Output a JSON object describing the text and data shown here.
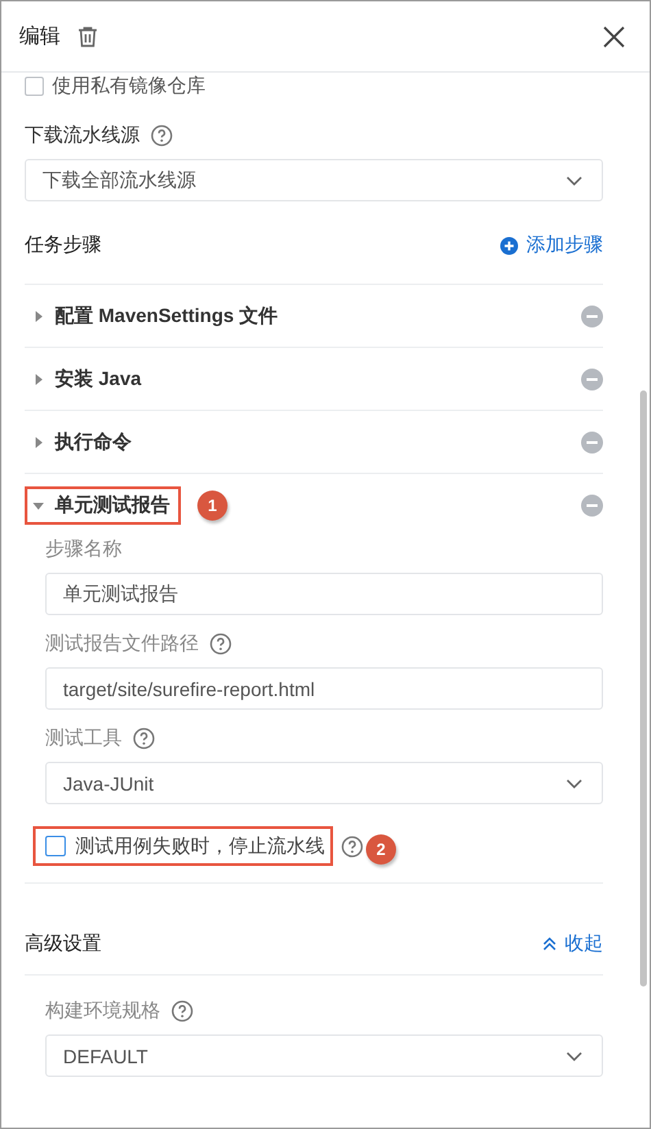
{
  "panel": {
    "title": "编辑"
  },
  "top_option": {
    "label": "使用私有镜像仓库",
    "checked": false
  },
  "download_source": {
    "label": "下载流水线源",
    "help": true,
    "value": "下载全部流水线源"
  },
  "steps_section": {
    "title": "任务步骤",
    "add_label": "添加步骤"
  },
  "steps": [
    {
      "title": "配置 MavenSettings 文件",
      "expanded": false,
      "highlighted": false
    },
    {
      "title": "安装 Java",
      "expanded": false,
      "highlighted": false
    },
    {
      "title": "执行命令",
      "expanded": false,
      "highlighted": false
    },
    {
      "title": "单元测试报告",
      "expanded": true,
      "highlighted": true,
      "callout": "1",
      "fields": [
        {
          "kind": "input",
          "label": "步骤名称",
          "help": false,
          "value": "单元测试报告"
        },
        {
          "kind": "input",
          "label": "测试报告文件路径",
          "help": true,
          "value": "target/site/surefire-report.html"
        },
        {
          "kind": "select",
          "label": "测试工具",
          "help": true,
          "value": "Java-JUnit"
        }
      ],
      "stop_option": {
        "label": "测试用例失败时，停止流水线",
        "checked": false,
        "help": true,
        "highlighted": true,
        "callout": "2"
      }
    }
  ],
  "advanced": {
    "title": "高级设置",
    "toggle_label": "收起",
    "expanded": true,
    "fields": [
      {
        "kind": "select",
        "label": "构建环境规格",
        "help": true,
        "value": "DEFAULT"
      }
    ]
  }
}
